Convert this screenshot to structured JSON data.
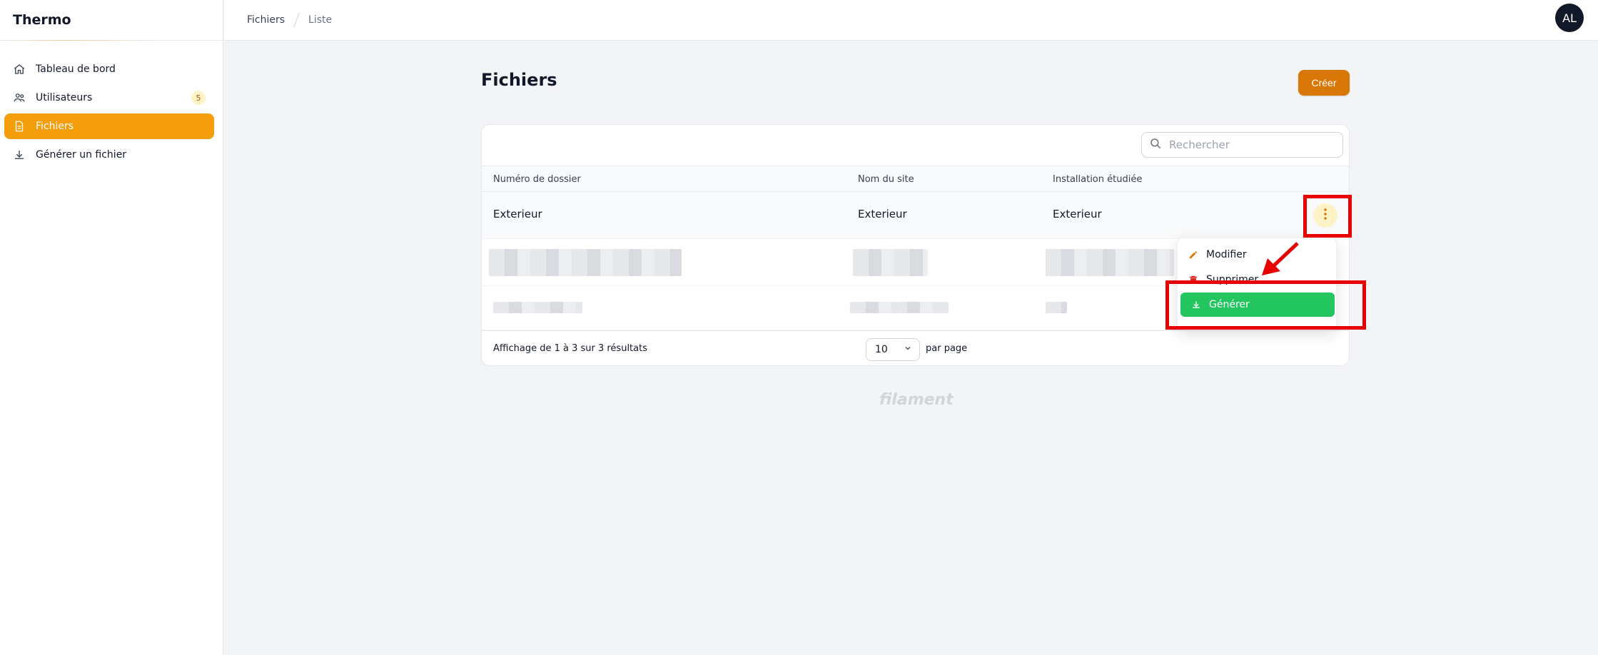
{
  "app": {
    "title": "Thermo"
  },
  "sidebar": {
    "items": [
      {
        "label": "Tableau de bord",
        "icon": "home-icon",
        "active": false
      },
      {
        "label": "Utilisateurs",
        "icon": "users-icon",
        "active": false,
        "badge": "5"
      },
      {
        "label": "Fichiers",
        "icon": "document-icon",
        "active": true
      },
      {
        "label": "Générer un fichier",
        "icon": "download-icon",
        "active": false
      }
    ]
  },
  "topbar": {
    "breadcrumb": [
      "Fichiers",
      "Liste"
    ],
    "avatar_initials": "AL"
  },
  "page": {
    "title": "Fichiers",
    "create_label": "Créer"
  },
  "search": {
    "placeholder": "Rechercher",
    "value": ""
  },
  "table": {
    "columns": [
      "Numéro de dossier",
      "Nom du site",
      "Installation étudiée"
    ],
    "rows": [
      {
        "numero": "Exterieur",
        "site": "Exterieur",
        "installation": "Exterieur"
      }
    ],
    "footer_text": "Affichage de 1 à 3 sur 3 résultats",
    "per_page_value": "10",
    "per_page_label": "par page"
  },
  "action_menu": {
    "items": [
      {
        "label": "Modifier",
        "icon": "pencil-icon"
      },
      {
        "label": "Supprimer",
        "icon": "trash-icon"
      },
      {
        "label": "Générer",
        "icon": "download-icon"
      }
    ]
  },
  "branding": {
    "footer_logo": "filament"
  },
  "colors": {
    "accent": "#f59e0b",
    "create_button": "#d97706",
    "generate_button": "#22c55e",
    "annotation": "#e60000"
  }
}
